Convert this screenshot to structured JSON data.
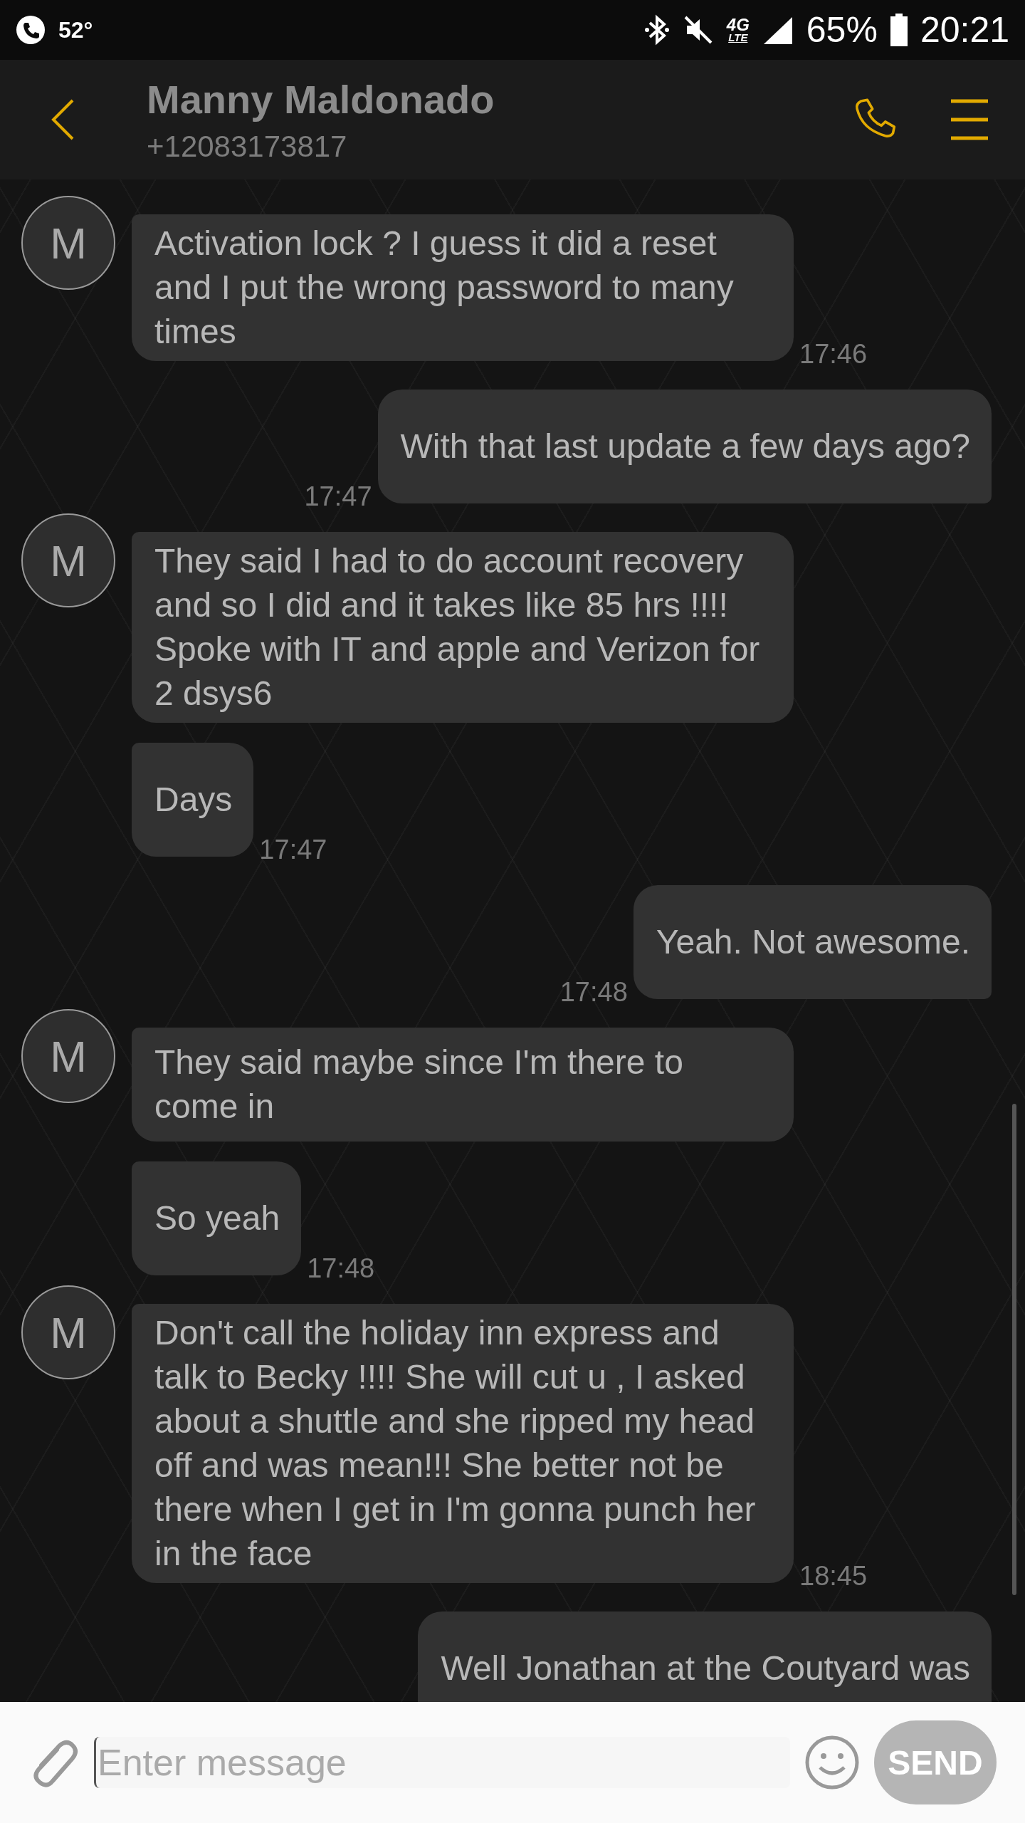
{
  "status_bar": {
    "temperature": "52°",
    "battery": "65%",
    "time": "20:21",
    "network": "4G",
    "network_sub": "LTE"
  },
  "header": {
    "name": "Manny Maldonado",
    "number": "+12083173817"
  },
  "messages": [
    {
      "kind": "incoming",
      "avatar": "M",
      "text": "Activation lock ? I guess it did a reset and I put the wrong password to many times",
      "time": "17:46"
    },
    {
      "kind": "outgoing",
      "text": "With that last update a few days ago?",
      "time": "17:47"
    },
    {
      "kind": "incoming",
      "avatar": "M",
      "text": "They said I had to do account recovery and so I did and it takes like 85 hrs !!!! Spoke with IT and apple and Verizon for 2 dsys6"
    },
    {
      "kind": "incoming",
      "text": "Days",
      "time": "17:47"
    },
    {
      "kind": "outgoing",
      "text": "Yeah. Not awesome.",
      "time": "17:48"
    },
    {
      "kind": "incoming",
      "avatar": "M",
      "text": "They said maybe since I'm there to come in"
    },
    {
      "kind": "incoming",
      "text": "So yeah",
      "time": "17:48"
    },
    {
      "kind": "incoming",
      "avatar": "M",
      "text": "Don't call the holiday inn express and talk to Becky !!!! She will cut u , I asked about a shuttle and she ripped my head off and was mean!!! She better not be there when I get in I'm gonna punch her in the face",
      "time": "18:45"
    },
    {
      "kind": "outgoing",
      "text": "Well Jonathan at the Coutyard was"
    }
  ],
  "composer": {
    "placeholder": "Enter message",
    "send": "SEND"
  }
}
